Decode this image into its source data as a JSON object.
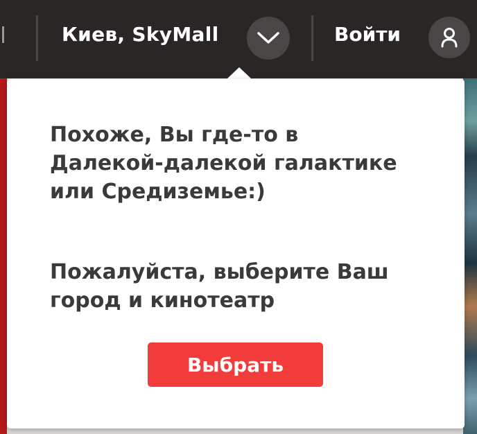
{
  "header": {
    "city_cinema": "Киев, SkyMall",
    "login_label": "Войти"
  },
  "popup": {
    "message_line1": "Похоже, Вы где-то в Далекой-далекой галактике или Средиземье:)",
    "message_line2": "Пожалуйста, выберите Ваш город и кинотеатр",
    "choose_button": "Выбрать"
  },
  "icons": {
    "dropdown": "chevron-down-icon",
    "account": "user-icon"
  },
  "colors": {
    "header_bg": "#2a2626",
    "accent": "#f23b3b",
    "popup_bg": "#ffffff",
    "text": "#3a3a3a"
  }
}
